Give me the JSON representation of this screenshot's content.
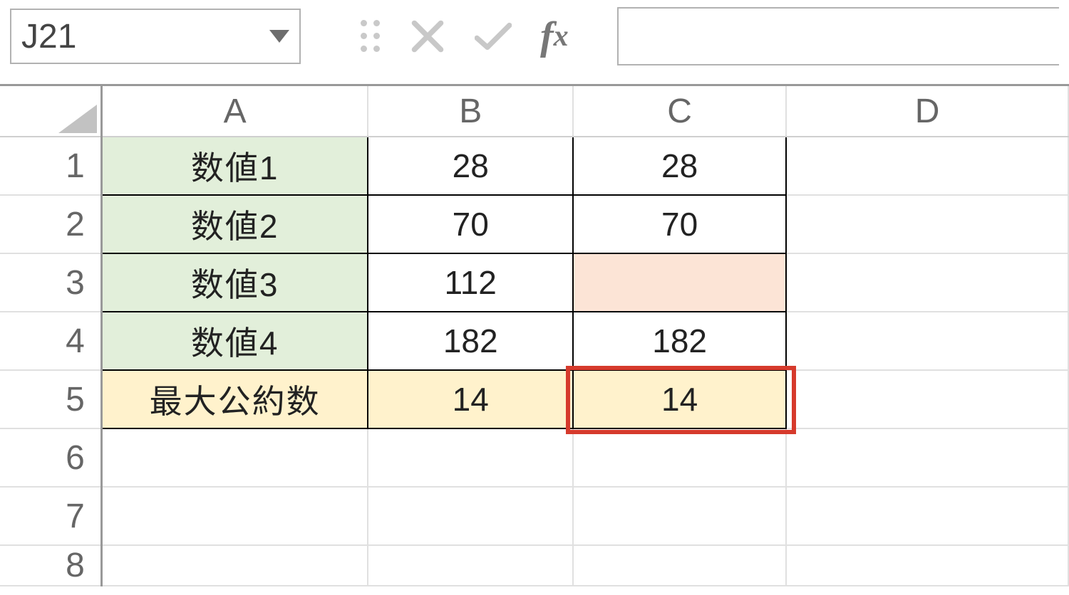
{
  "nameBox": {
    "ref": "J21"
  },
  "columns": [
    "A",
    "B",
    "C",
    "D"
  ],
  "rowNumbers": [
    "1",
    "2",
    "3",
    "4",
    "5",
    "6",
    "7",
    "8"
  ],
  "cells": {
    "A1": "数値1",
    "B1": "28",
    "C1": "28",
    "A2": "数値2",
    "B2": "70",
    "C2": "70",
    "A3": "数値3",
    "B3": "112",
    "C3": "",
    "A4": "数値4",
    "B4": "182",
    "C4": "182",
    "A5": "最大公約数",
    "B5": "14",
    "C5": "14"
  },
  "formulaInput": "",
  "highlightCell": "C5"
}
